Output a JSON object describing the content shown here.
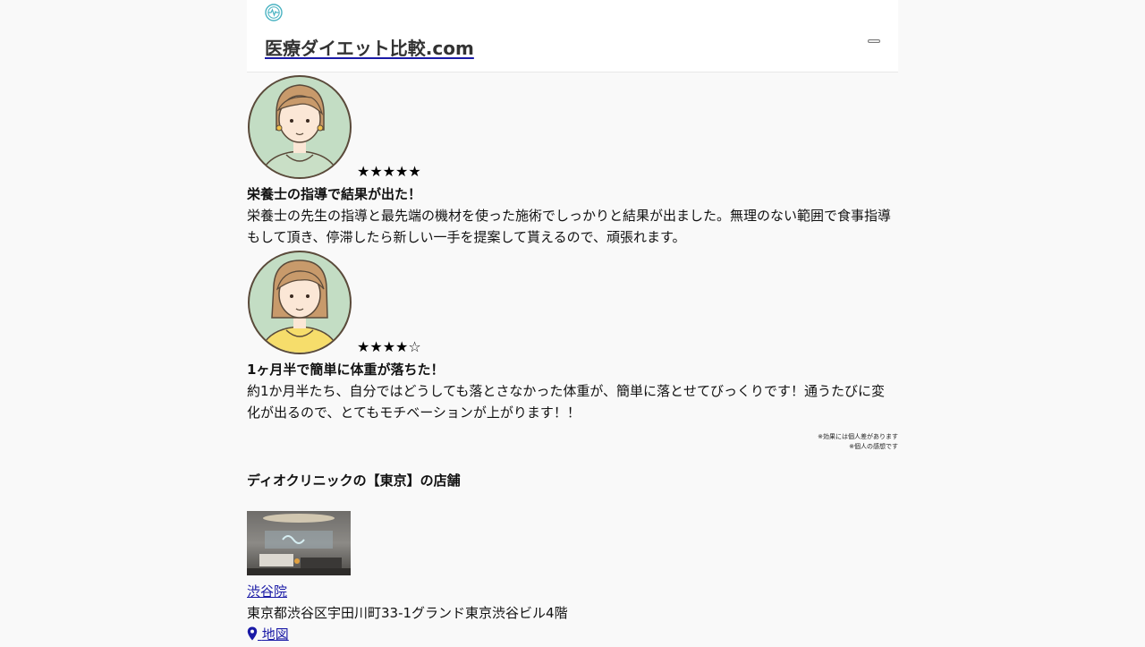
{
  "header": {
    "site_title": "医療ダイエット比較.com",
    "logo_icon": "medical-logo-icon",
    "menu_button": "hamburger-menu-icon"
  },
  "reviews": [
    {
      "stars": "★★★★★",
      "rating": 5,
      "title": "栄養士の指導で結果が出た！",
      "body": "栄養士の先生の指導と最先端の機材を使った施術でしっかりと結果が出ました。無理のない範囲で食事指導もして頂き、停滞したら新しい一手を提案して貰えるので、頑張れます。",
      "avatar_icon": "woman-avatar-icon",
      "shirt_color": "#c9dfc6"
    },
    {
      "stars": "★★★★☆",
      "rating": 4,
      "title": "1ヶ月半で簡単に体重が落ちた！",
      "body": "約1か月半たち、自分ではどうしても落とさなかった体重が、簡単に落とせてびっくりです！通うたびに変化が出るので、とてもモチベーションが上がります！！",
      "avatar_icon": "woman-avatar-icon",
      "shirt_color": "#f6dd6b"
    }
  ],
  "notes": [
    "※効果には個人差があります",
    "※個人の感想です"
  ],
  "section": {
    "title": "ディオクリニックの【東京】の店舗"
  },
  "clinic": {
    "name": "渋谷院",
    "address": "東京都渋谷区宇田川町33-1グランド東京渋谷ビル4階",
    "map_label": "地図",
    "map_icon": "map-pin-icon"
  },
  "colors": {
    "background": "#f9f9f9",
    "header_bg": "#ffffff",
    "link": "#1a1aa6",
    "logo": "#4ab3c2",
    "avatar_bg": "#c3ddc4"
  }
}
